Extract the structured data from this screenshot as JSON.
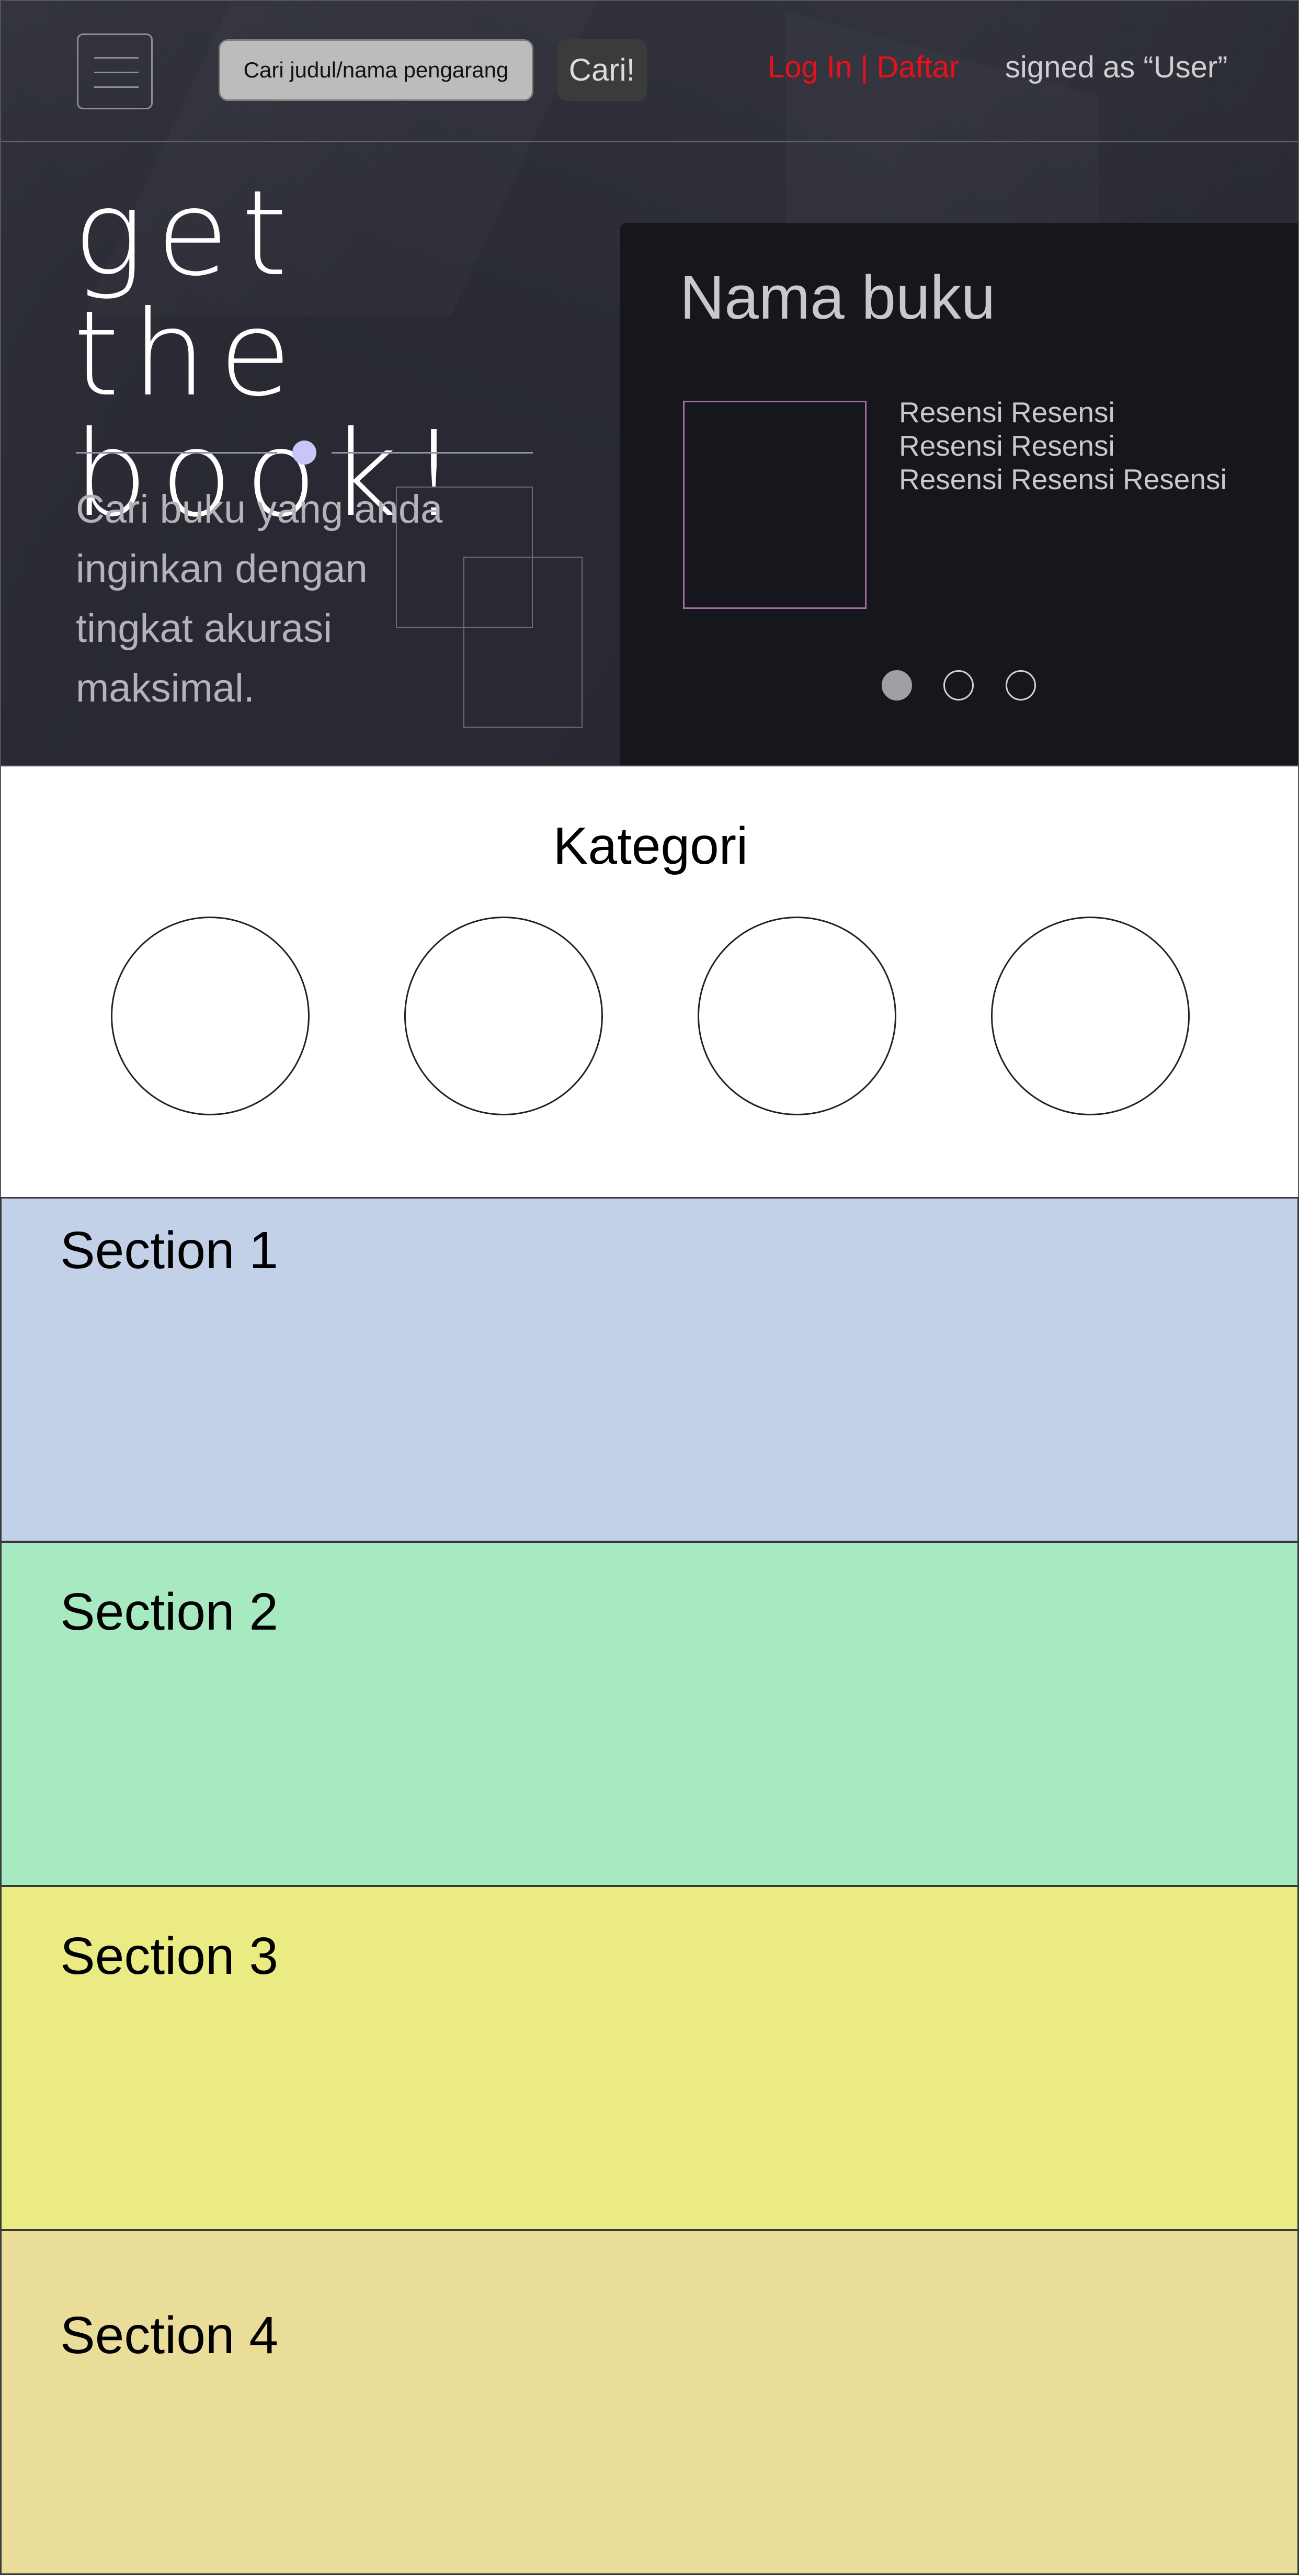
{
  "navbar": {
    "search_placeholder": "Cari judul/nama pengarang",
    "search_button": "Cari!",
    "login_link": "Log In | Daftar",
    "signed_as": "signed as “User”",
    "menu_icon": "hamburger-menu-icon"
  },
  "hero": {
    "title_line1": "get the",
    "title_line2": "book!",
    "description": "Cari buku yang anda inginkan dengan tingkat akurasi maksimal."
  },
  "carousel": {
    "book_title": "Nama buku",
    "review_lines": [
      "Resensi Resensi",
      "Resensi Resensi",
      "Resensi Resensi Resensi"
    ],
    "active_slide": 1,
    "slide_count": 3
  },
  "categories": {
    "title": "Kategori"
  },
  "sections": [
    {
      "label": "Section 1",
      "color": "#c3d1e8"
    },
    {
      "label": "Section 2",
      "color": "#a7e9c0"
    },
    {
      "label": "Section 3",
      "color": "#eaec83"
    },
    {
      "label": "Section 4",
      "color": "#eadd9a"
    }
  ],
  "colors": {
    "login_link": "#e8101b",
    "dark_background": "#2b2c36",
    "carousel_background": "#16171c",
    "accent_dot": "#c9c5f8"
  }
}
